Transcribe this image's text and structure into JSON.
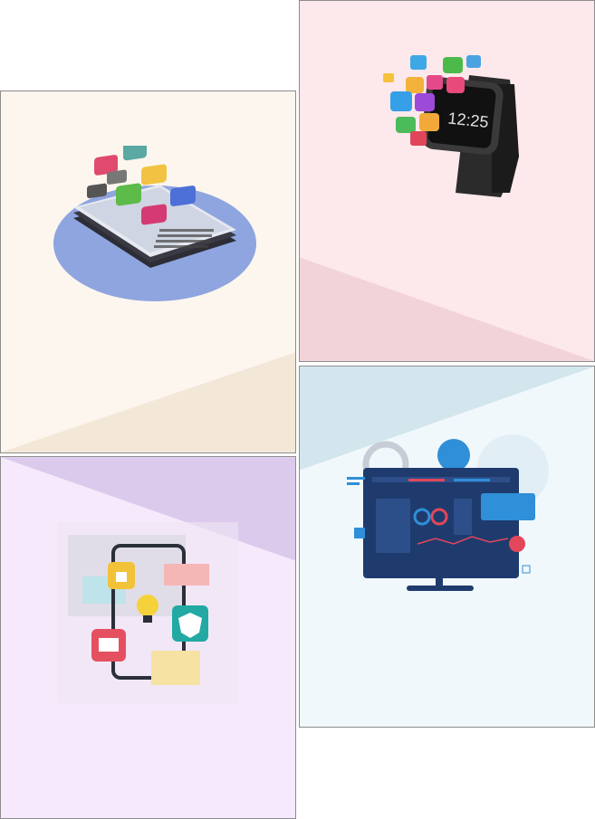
{
  "cards": [
    {
      "name": "mobile-app-development",
      "bg": "#fdf6ee",
      "accent": "#f3e7d8",
      "icon": "stacked-smartphone-app-icons"
    },
    {
      "name": "smartwatch-apps",
      "bg": "#fde9ec",
      "accent": "#f2d3d8",
      "icon": "smartwatch-icon"
    },
    {
      "name": "smartphone-security",
      "bg": "#f5e9fb",
      "accent": "#dccaec",
      "icon": "smartphone-lightbulb-icon"
    },
    {
      "name": "web-dashboard-development",
      "bg": "#f1f8fb",
      "accent": "#d3e6ee",
      "icon": "desktop-monitor-dashboard-icon"
    }
  ],
  "colors": {
    "ellipse": "#8ea5df",
    "watch": "#2b2b2b",
    "monitor": "#1f3b6e",
    "accent_red": "#e2475a",
    "accent_blue": "#2f8fd8"
  }
}
